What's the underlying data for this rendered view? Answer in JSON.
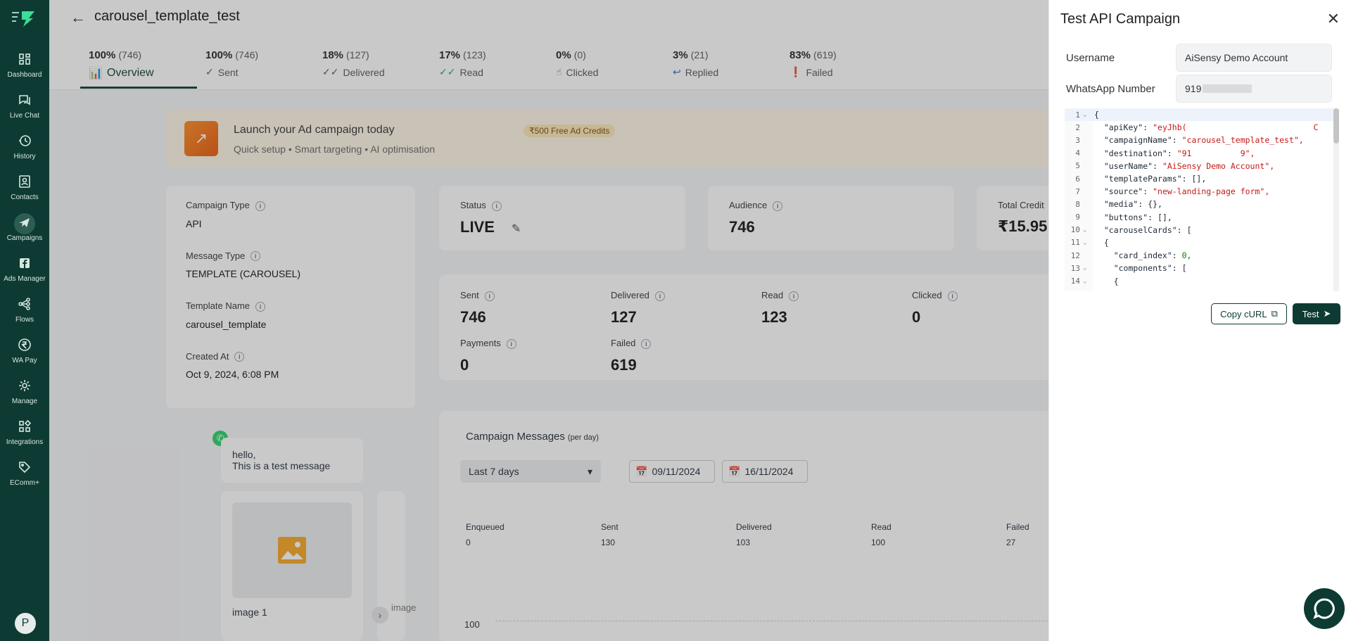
{
  "sidebar": {
    "items": [
      {
        "label": "Dashboard",
        "icon": "dashboard-icon"
      },
      {
        "label": "Live Chat",
        "icon": "chat-icon"
      },
      {
        "label": "History",
        "icon": "history-icon"
      },
      {
        "label": "Contacts",
        "icon": "contacts-icon"
      },
      {
        "label": "Campaigns",
        "icon": "campaign-icon"
      },
      {
        "label": "Ads Manager",
        "icon": "facebook-icon"
      },
      {
        "label": "Flows",
        "icon": "flows-icon"
      },
      {
        "label": "WA Pay",
        "icon": "rupee-icon"
      },
      {
        "label": "Manage",
        "icon": "gear-icon"
      },
      {
        "label": "Integrations",
        "icon": "grid-icon"
      },
      {
        "label": "EComm+",
        "icon": "tag-icon"
      }
    ],
    "avatar_initial": "P"
  },
  "header": {
    "title": "carousel_template_test"
  },
  "tabs": [
    {
      "pct": "100%",
      "count": "(746)",
      "label": "Overview"
    },
    {
      "pct": "100%",
      "count": "(746)",
      "label": "Sent"
    },
    {
      "pct": "18%",
      "count": "(127)",
      "label": "Delivered"
    },
    {
      "pct": "17%",
      "count": "(123)",
      "label": "Read"
    },
    {
      "pct": "0%",
      "count": "(0)",
      "label": "Clicked"
    },
    {
      "pct": "3%",
      "count": "(21)",
      "label": "Replied"
    },
    {
      "pct": "83%",
      "count": "(619)",
      "label": "Failed"
    }
  ],
  "banner": {
    "title": "Launch your Ad campaign today",
    "badge": "₹500 Free Ad Credits",
    "subtitle": "Quick setup • Smart targeting • AI optimisation"
  },
  "details": {
    "campaign_type_label": "Campaign Type",
    "campaign_type": "API",
    "message_type_label": "Message Type",
    "message_type": "TEMPLATE (CAROUSEL)",
    "template_name_label": "Template Name",
    "template_name": "carousel_template",
    "created_at_label": "Created At",
    "created_at": "Oct 9, 2024, 6:08 PM"
  },
  "status": {
    "label": "Status",
    "value": "LIVE"
  },
  "audience": {
    "label": "Audience",
    "value": "746"
  },
  "credit": {
    "label": "Total Credit",
    "value": "₹15.95"
  },
  "stats": [
    {
      "label": "Sent",
      "value": "746"
    },
    {
      "label": "Delivered",
      "value": "127"
    },
    {
      "label": "Read",
      "value": "123"
    },
    {
      "label": "Clicked",
      "value": "0"
    },
    {
      "label": "Payments",
      "value": "0"
    },
    {
      "label": "Failed",
      "value": "619"
    }
  ],
  "preview": {
    "message": "hello,\nThis is a test message",
    "card_caption": "image 1",
    "next_caption": "image"
  },
  "campaign_messages": {
    "title": "Campaign Messages",
    "suffix": "(per day)",
    "range": "Last 7 days",
    "date_from": "09/11/2024",
    "date_to": "16/11/2024",
    "columns": [
      {
        "label": "Enqueued",
        "value": "0"
      },
      {
        "label": "Sent",
        "value": "130"
      },
      {
        "label": "Delivered",
        "value": "103"
      },
      {
        "label": "Read",
        "value": "100"
      },
      {
        "label": "Failed",
        "value": "27"
      }
    ],
    "y_tick": "100"
  },
  "drawer": {
    "title": "Test API Campaign",
    "username_label": "Username",
    "username": "AiSensy Demo Account",
    "whatsapp_label": "WhatsApp Number",
    "whatsapp_prefix": "919",
    "copy_label": "Copy cURL",
    "test_label": "Test",
    "code_lines": [
      {
        "n": "1",
        "text": "{"
      },
      {
        "n": "2",
        "key": "\"apiKey\"",
        "val": "\"eyJhb(                          C"
      },
      {
        "n": "3",
        "key": "\"campaignName\"",
        "val": "\"carousel_template_test\","
      },
      {
        "n": "4",
        "key": "\"destination\"",
        "val": "\"91          9\","
      },
      {
        "n": "5",
        "key": "\"userName\"",
        "val": "\"AiSensy Demo Account\","
      },
      {
        "n": "6",
        "key": "\"templateParams\"",
        "val": "[],"
      },
      {
        "n": "7",
        "key": "\"source\"",
        "val": "\"new-landing-page form\","
      },
      {
        "n": "8",
        "key": "\"media\"",
        "val": "{},"
      },
      {
        "n": "9",
        "key": "\"buttons\"",
        "val": "[],"
      },
      {
        "n": "10",
        "key": "\"carouselCards\"",
        "val": "["
      },
      {
        "n": "11",
        "text": "  {"
      },
      {
        "n": "12",
        "key": "  \"card_index\"",
        "val": "0,"
      },
      {
        "n": "13",
        "key": "  \"components\"",
        "val": "["
      },
      {
        "n": "14",
        "text": "    {"
      }
    ]
  }
}
